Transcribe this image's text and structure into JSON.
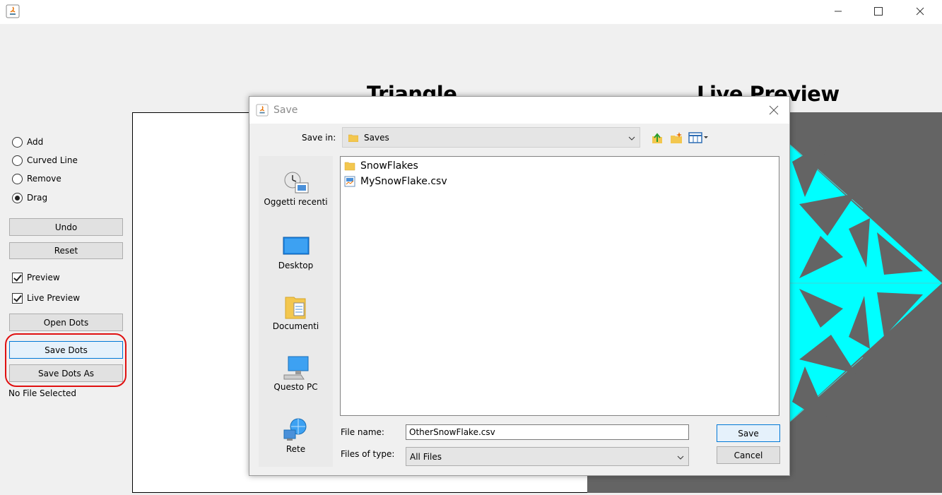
{
  "window": {
    "title": "",
    "controls": {
      "minimize": "—",
      "maximize": "☐",
      "close": "✕"
    }
  },
  "headings": {
    "triangle": "Triangle",
    "live_preview": "Live Preview"
  },
  "left_panel": {
    "modes": [
      {
        "label": "Add",
        "selected": false
      },
      {
        "label": "Curved Line",
        "selected": false
      },
      {
        "label": "Remove",
        "selected": false
      },
      {
        "label": "Drag",
        "selected": true
      }
    ],
    "undo_label": "Undo",
    "reset_label": "Reset",
    "preview_label": "Preview",
    "preview_checked": true,
    "live_preview_label": "Live Preview",
    "live_preview_checked": true,
    "open_dots_label": "Open Dots",
    "save_dots_label": "Save Dots",
    "save_dots_as_label": "Save Dots As",
    "status_label": "No File Selected"
  },
  "live_preview_colors": {
    "background": "#646464",
    "snowflake": "#00ffff"
  },
  "annotation": {
    "color": "#e01010"
  },
  "dialog": {
    "title": "Save",
    "save_in_label": "Save in:",
    "save_in_value": "Saves",
    "places": [
      {
        "label": "Oggetti recenti",
        "icon": "recent-items-icon"
      },
      {
        "label": "Desktop",
        "icon": "desktop-icon"
      },
      {
        "label": "Documenti",
        "icon": "documents-icon"
      },
      {
        "label": "Questo PC",
        "icon": "computer-icon"
      },
      {
        "label": "Rete",
        "icon": "network-icon"
      }
    ],
    "files": [
      {
        "name": "SnowFlakes",
        "icon": "folder-icon"
      },
      {
        "name": "MySnowFlake.csv",
        "icon": "file-icon"
      }
    ],
    "file_name_label": "File name:",
    "file_name_value": "OtherSnowFlake.csv",
    "file_type_label": "Files of type:",
    "file_type_value": "All Files",
    "save_label": "Save",
    "cancel_label": "Cancel"
  }
}
